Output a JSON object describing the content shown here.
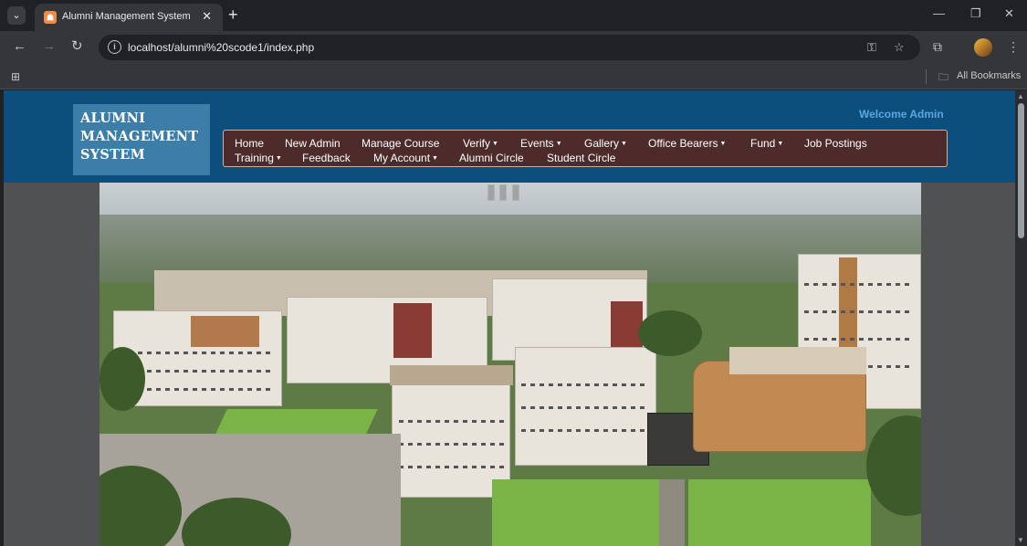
{
  "browser": {
    "tab_title": "Alumni Management System",
    "tab_close": "✕",
    "new_tab": "+",
    "url": "localhost/alumni%20scode1/index.php",
    "bookmarks_label": "All Bookmarks",
    "icons": [
      "tab-search-icon",
      "favicon-icon",
      "close-icon",
      "new-tab-icon",
      "minimize-icon",
      "restore-icon",
      "window-close-icon",
      "back-icon",
      "forward-icon",
      "reload-icon",
      "site-info-icon",
      "password-key-icon",
      "bookmark-star-icon",
      "extensions-icon",
      "profile-avatar-icon",
      "menu-icon",
      "apps-icon",
      "folder-icon"
    ]
  },
  "site": {
    "logo_lines": [
      "ALUMNI",
      "MANAGEMENT",
      "SYSTEM"
    ],
    "welcome": "Welcome Admin",
    "nav_row1": [
      {
        "label": "Home",
        "dropdown": false
      },
      {
        "label": "New Admin",
        "dropdown": false
      },
      {
        "label": "Manage Course",
        "dropdown": false
      },
      {
        "label": "Verify",
        "dropdown": true
      },
      {
        "label": "Events",
        "dropdown": true
      },
      {
        "label": "Gallery",
        "dropdown": true
      },
      {
        "label": "Office Bearers",
        "dropdown": true
      },
      {
        "label": "Fund",
        "dropdown": true
      },
      {
        "label": "Job Postings",
        "dropdown": false
      }
    ],
    "nav_row2": [
      {
        "label": "Training",
        "dropdown": true
      },
      {
        "label": "Feedback",
        "dropdown": false
      },
      {
        "label": "My Account",
        "dropdown": true
      },
      {
        "label": "Alumni Circle",
        "dropdown": false
      },
      {
        "label": "Student Circle",
        "dropdown": false
      }
    ],
    "colors": {
      "header": "#0d4f7c",
      "logo_bg": "#3d7ea8",
      "menu_bg": "#4e2b2b",
      "welcome": "#5aa6e0"
    }
  }
}
